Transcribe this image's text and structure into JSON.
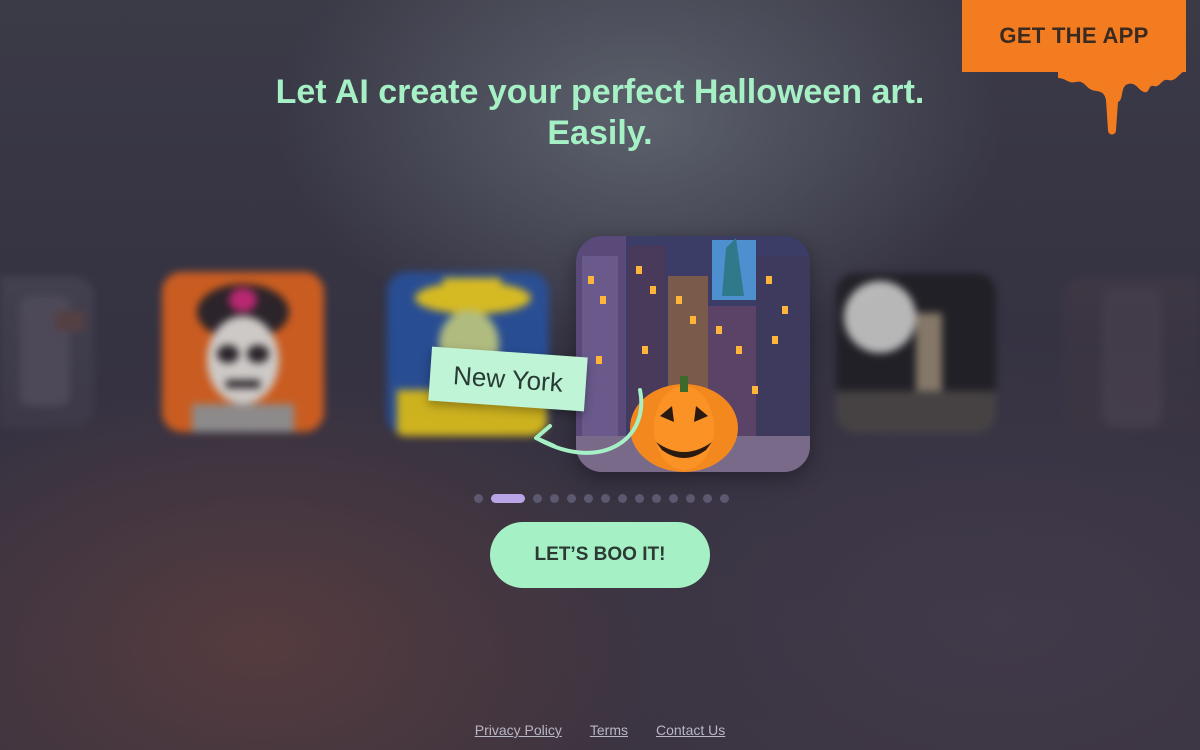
{
  "header": {
    "get_app_label": "GET THE APP",
    "accent_color": "#f47c20"
  },
  "hero": {
    "headline_line1": "Let AI create your perfect Halloween art.",
    "headline_line2": "Easily.",
    "headline_color": "#a6f0c6"
  },
  "carousel": {
    "current_label": "New York",
    "active_index": 1,
    "dot_count": 15,
    "cards": [
      {
        "name": "ghost-art"
      },
      {
        "name": "skeleton-portrait-art"
      },
      {
        "name": "yellow-hat-art"
      },
      {
        "name": "new-york-pumpkin-art"
      },
      {
        "name": "moon-skeleton-art"
      },
      {
        "name": "ghost-art-right"
      }
    ]
  },
  "cta": {
    "label": "LET’S BOO IT!"
  },
  "footer": {
    "links": [
      {
        "label": "Privacy Policy"
      },
      {
        "label": "Terms"
      },
      {
        "label": "Contact Us"
      }
    ]
  }
}
